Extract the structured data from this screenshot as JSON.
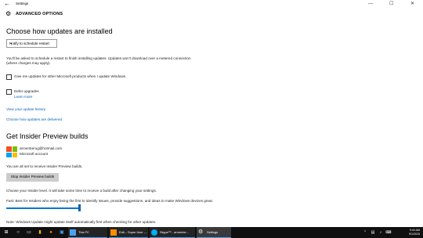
{
  "window": {
    "title": "Settings",
    "minimize": "—",
    "maximize": "☐",
    "close": "✕"
  },
  "header": {
    "title": "ADVANCED OPTIONS"
  },
  "sections": {
    "install": {
      "title": "Choose how updates are installed",
      "dropdown_value": "Notify to schedule restart",
      "note_line1": "You'll be asked to schedule a restart to finish installing updates. Updates won't download over a metered connection",
      "note_line2": "(where charges may apply).",
      "checkbox_ms_label": "Give me updates for other Microsoft products when I update Windows.",
      "checkbox_defer_label": "Defer upgrades",
      "learn_more": "Learn more",
      "history_link": "View your update history",
      "delivery_link": "Choose how updates are delivered"
    },
    "insider": {
      "title": "Get Insider Preview builds",
      "email": "armenberug@hotmail.com",
      "account_type": "Microsoft account",
      "status": "You are all set to receive Insider Preview builds.",
      "stop_button": "Stop Insider Preview builds",
      "level_prompt": "Choose your Insider level. It will take some time to receive a build after changing your settings.",
      "level_desc": "Fast: Best for Insiders who enjoy being the first to identify issues, provide suggestions, and ideas to make Windows devices great.",
      "level_value": 1.0,
      "footer_note": "Note: Windows Update might update itself automatically first when checking for other updates."
    }
  },
  "taskbar": {
    "apps": [
      {
        "label": "This PC"
      },
      {
        "label": "Edit – Super User -..."
      },
      {
        "label": "Skype™ - armenbe..."
      },
      {
        "label": "Settings"
      }
    ],
    "time": "9:44 AM",
    "date": "9/1/2015"
  },
  "colors": {
    "accent": "#0078d7",
    "link": "#0063b1",
    "taskbar": "#101010",
    "button": "#cccccc"
  }
}
